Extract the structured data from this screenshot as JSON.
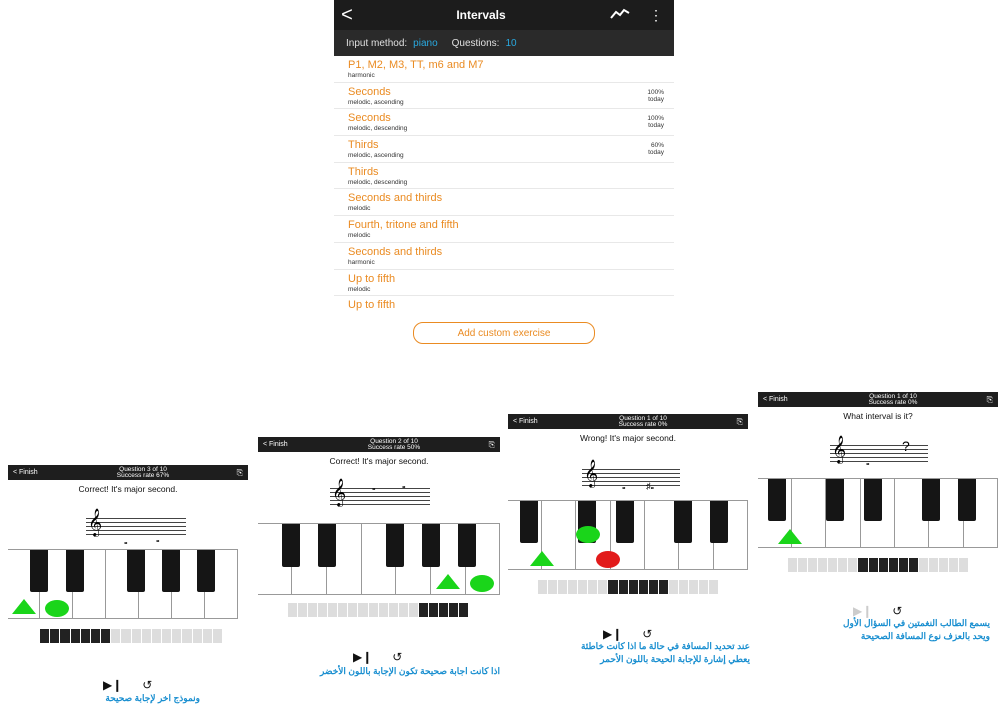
{
  "app": {
    "title": "Intervals",
    "back": "<",
    "input_label": "Input method:",
    "input_value": "piano",
    "questions_label": "Questions:",
    "questions_value": "10",
    "add_button": "Add custom exercise",
    "accent_color": "#ea8b22",
    "exercises": [
      {
        "name": "P1, M2, M3, TT, m6 and M7",
        "kind": "harmonic",
        "rate": "",
        "when": ""
      },
      {
        "name": "Seconds",
        "kind": "melodic, ascending",
        "rate": "100%",
        "when": "today"
      },
      {
        "name": "Seconds",
        "kind": "melodic, descending",
        "rate": "100%",
        "when": "today"
      },
      {
        "name": "Thirds",
        "kind": "melodic, ascending",
        "rate": "60%",
        "when": "today"
      },
      {
        "name": "Thirds",
        "kind": "melodic, descending",
        "rate": "",
        "when": ""
      },
      {
        "name": "Seconds and thirds",
        "kind": "melodic",
        "rate": "",
        "when": ""
      },
      {
        "name": "Fourth, tritone and fifth",
        "kind": "melodic",
        "rate": "",
        "when": ""
      },
      {
        "name": "Seconds and thirds",
        "kind": "harmonic",
        "rate": "",
        "when": ""
      },
      {
        "name": "Up to fifth",
        "kind": "melodic",
        "rate": "",
        "when": ""
      },
      {
        "name": "Up to fifth",
        "kind": "",
        "rate": "",
        "when": ""
      }
    ]
  },
  "panels": {
    "p1": {
      "finish": "< Finish",
      "question": "Question 3 of 10",
      "rate": "Success rate 67%",
      "message": "Correct! It's major second.",
      "caption": [
        "ونموذج اخر لإجابة صحيحة"
      ]
    },
    "p2": {
      "finish": "< Finish",
      "question": "Question 2 of 10",
      "rate": "Success rate 50%",
      "message": "Correct! It's major second.",
      "caption": [
        "اذا كانت اجابة صحيحة تكون الإجابة باللون الأخضر"
      ]
    },
    "p3": {
      "finish": "< Finish",
      "question": "Question 1 of 10",
      "rate": "Success rate 0%",
      "message": "Wrong! It's major second.",
      "caption": [
        "عند تحديد المسافة في حالة ما اذا كانت خاطئة",
        "يعطي إشارة للإجابة الحيحة باللون الأحمر"
      ]
    },
    "p4": {
      "finish": "< Finish",
      "question": "Question 1 of 10",
      "rate": "Success rate 0%",
      "message": "What interval is it?",
      "caption": [
        "يسمع الطالب النغمتين في السؤال الأول",
        "ويحد بالعزف نوع المسافة الصحيحة"
      ]
    }
  },
  "colors": {
    "correct": "#1ad51a",
    "wrong": "#e21b1b",
    "caption": "#1a8fd0"
  }
}
